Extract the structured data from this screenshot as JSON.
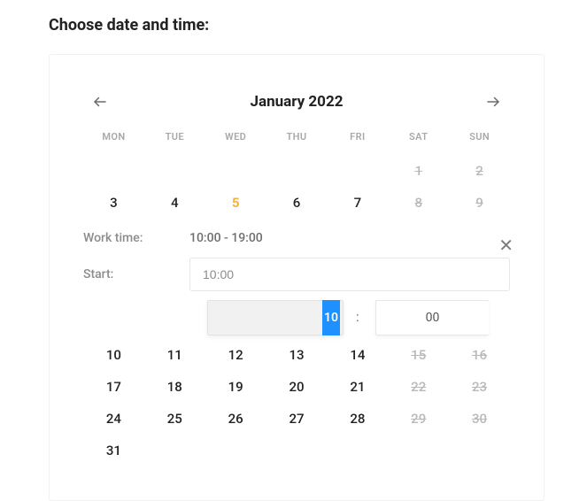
{
  "heading": "Choose date and time:",
  "calendar": {
    "month_title": "January 2022",
    "weekdays": [
      "MON",
      "TUE",
      "WED",
      "THU",
      "FRI",
      "SAT",
      "SUN"
    ],
    "rows_top": [
      [
        {
          "d": "",
          "t": "empty"
        },
        {
          "d": "",
          "t": "empty"
        },
        {
          "d": "",
          "t": "empty"
        },
        {
          "d": "",
          "t": "empty"
        },
        {
          "d": "",
          "t": "empty"
        },
        {
          "d": "1",
          "t": "disabled"
        },
        {
          "d": "2",
          "t": "disabled"
        }
      ],
      [
        {
          "d": "3",
          "t": "normal"
        },
        {
          "d": "4",
          "t": "normal"
        },
        {
          "d": "5",
          "t": "today"
        },
        {
          "d": "6",
          "t": "normal"
        },
        {
          "d": "7",
          "t": "normal"
        },
        {
          "d": "8",
          "t": "disabled"
        },
        {
          "d": "9",
          "t": "disabled"
        }
      ]
    ],
    "rows_bottom": [
      [
        {
          "d": "10",
          "t": "normal"
        },
        {
          "d": "11",
          "t": "normal"
        },
        {
          "d": "12",
          "t": "normal"
        },
        {
          "d": "13",
          "t": "normal"
        },
        {
          "d": "14",
          "t": "normal"
        },
        {
          "d": "15",
          "t": "disabled"
        },
        {
          "d": "16",
          "t": "disabled"
        }
      ],
      [
        {
          "d": "17",
          "t": "normal"
        },
        {
          "d": "18",
          "t": "normal"
        },
        {
          "d": "19",
          "t": "normal"
        },
        {
          "d": "20",
          "t": "normal"
        },
        {
          "d": "21",
          "t": "normal"
        },
        {
          "d": "22",
          "t": "disabled"
        },
        {
          "d": "23",
          "t": "disabled"
        }
      ],
      [
        {
          "d": "24",
          "t": "normal"
        },
        {
          "d": "25",
          "t": "normal"
        },
        {
          "d": "26",
          "t": "normal"
        },
        {
          "d": "27",
          "t": "normal"
        },
        {
          "d": "28",
          "t": "normal"
        },
        {
          "d": "29",
          "t": "disabled"
        },
        {
          "d": "30",
          "t": "disabled"
        }
      ],
      [
        {
          "d": "31",
          "t": "normal"
        },
        {
          "d": "",
          "t": "empty"
        },
        {
          "d": "",
          "t": "empty"
        },
        {
          "d": "",
          "t": "empty"
        },
        {
          "d": "",
          "t": "empty"
        },
        {
          "d": "",
          "t": "empty"
        },
        {
          "d": "",
          "t": "empty"
        }
      ]
    ]
  },
  "time_panel": {
    "work_time_label": "Work time:",
    "work_time_value": "10:00 - 19:00",
    "start_label": "Start:",
    "start_value": "10:00",
    "hour_selected": "10",
    "minute_selected": "00",
    "close_glyph": "✕",
    "colon": ":"
  }
}
